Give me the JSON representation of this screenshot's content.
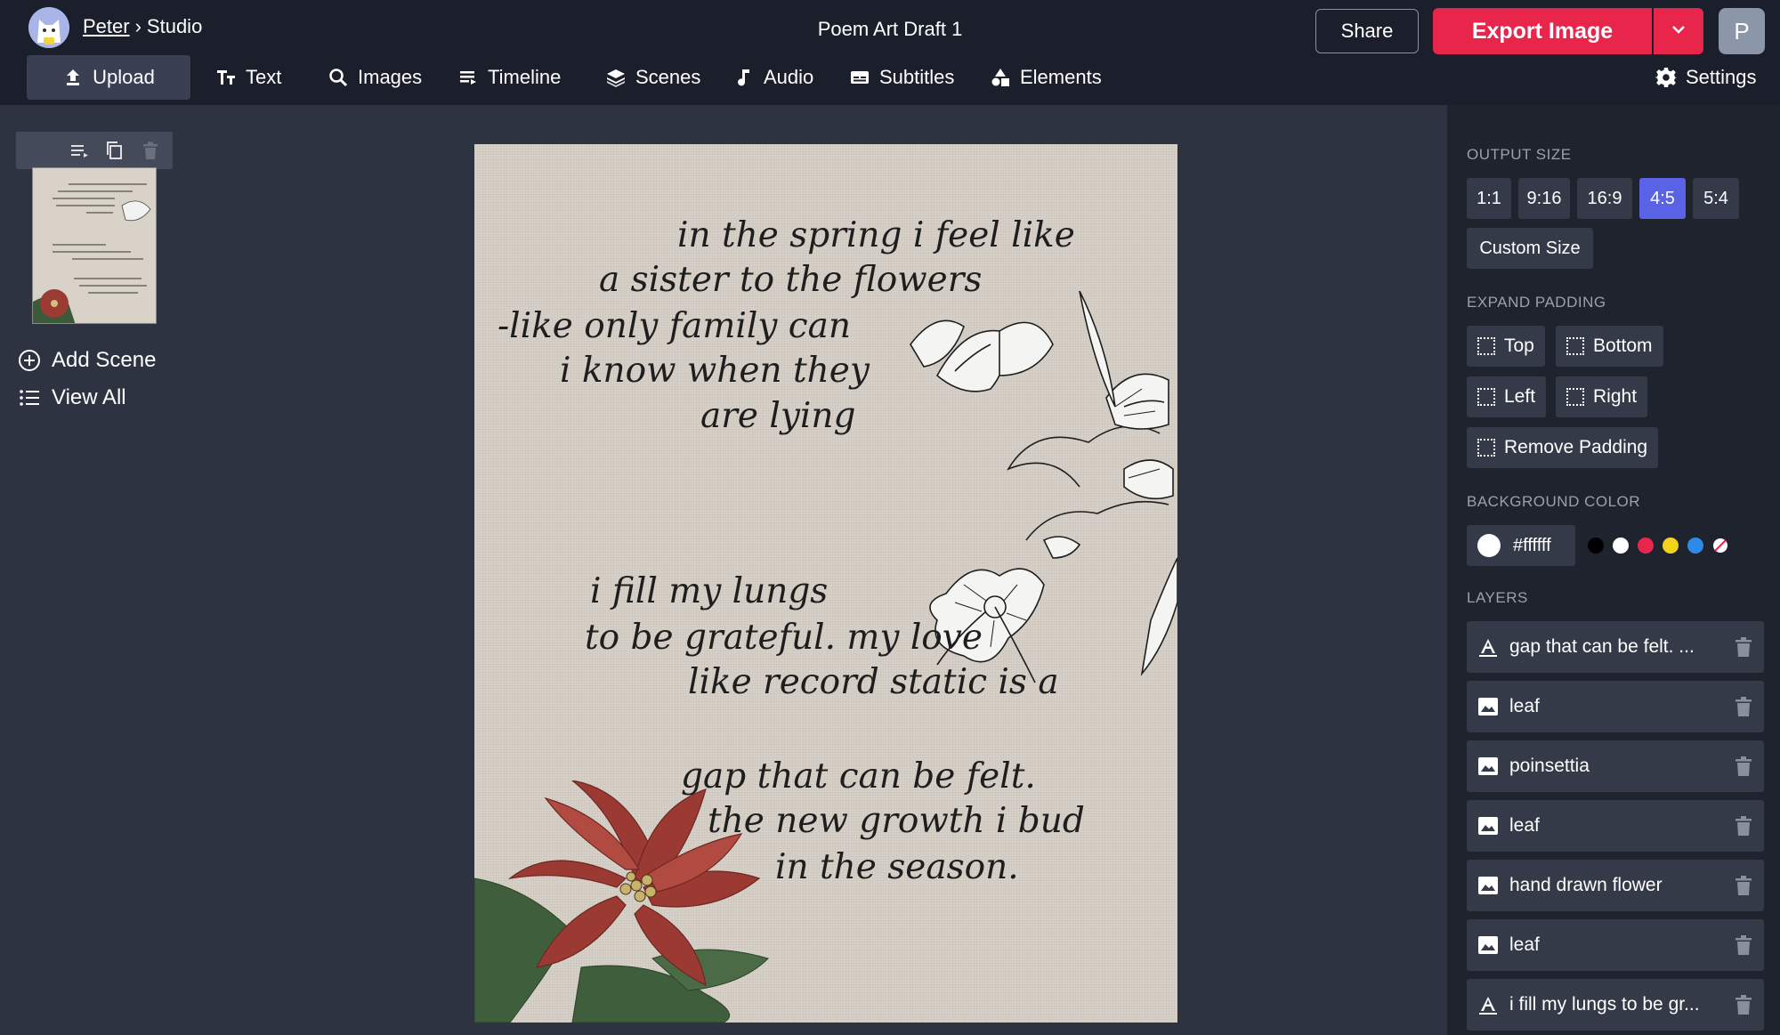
{
  "header": {
    "user": "Peter",
    "separator": "›",
    "section": "Studio",
    "document_title": "Poem Art Draft 1",
    "share_label": "Share",
    "export_label": "Export Image",
    "profile_initial": "P"
  },
  "toolbar": {
    "upload": "Upload",
    "text": "Text",
    "images": "Images",
    "timeline": "Timeline",
    "scenes": "Scenes",
    "audio": "Audio",
    "subtitles": "Subtitles",
    "elements": "Elements",
    "settings": "Settings"
  },
  "scenes_panel": {
    "add_scene": "Add Scene",
    "view_all": "View All"
  },
  "canvas": {
    "poem_lines": [
      "in the spring i feel like",
      "a sister to the flowers",
      "-like only family can",
      "i know when they",
      "are lying",
      "i fill my lungs",
      "to be grateful. my love",
      "like record static is a",
      "gap that can be felt.",
      "the new growth i bud",
      "in the season."
    ]
  },
  "sidebar": {
    "output_size_label": "OUTPUT SIZE",
    "sizes": [
      "1:1",
      "9:16",
      "16:9",
      "4:5",
      "5:4"
    ],
    "active_size": "4:5",
    "custom_size": "Custom Size",
    "expand_padding_label": "EXPAND PADDING",
    "padding": {
      "top": "Top",
      "bottom": "Bottom",
      "left": "Left",
      "right": "Right",
      "remove": "Remove Padding"
    },
    "background_color_label": "BACKGROUND COLOR",
    "background_color_value": "#ffffff",
    "swatches": [
      "#000000",
      "#ffffff",
      "#e8264c",
      "#f2d31b",
      "#2d8ae8"
    ],
    "layers_label": "LAYERS",
    "layers": [
      {
        "name": "gap that can be felt.   ...",
        "type": "text"
      },
      {
        "name": "leaf",
        "type": "image"
      },
      {
        "name": "poinsettia",
        "type": "image"
      },
      {
        "name": "leaf",
        "type": "image"
      },
      {
        "name": "hand drawn flower",
        "type": "image"
      },
      {
        "name": "leaf",
        "type": "image"
      },
      {
        "name": "i fill my lungs to be gr...",
        "type": "text"
      }
    ]
  }
}
